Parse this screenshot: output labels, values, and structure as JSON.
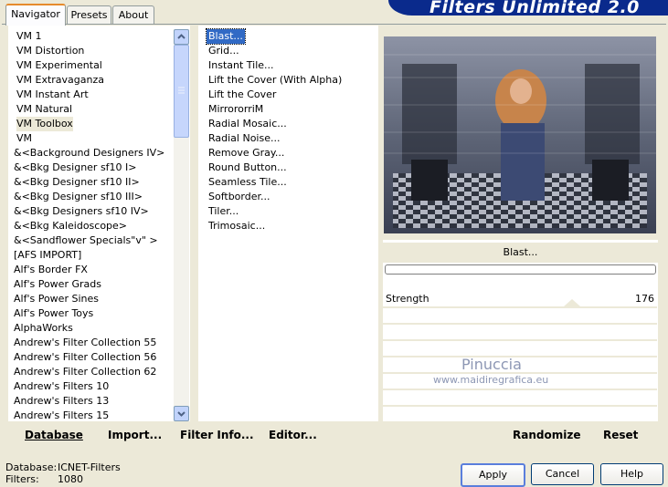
{
  "tabs": [
    {
      "label": "Navigator"
    },
    {
      "label": "Presets"
    },
    {
      "label": "About"
    }
  ],
  "header": {
    "title": "Filters Unlimited 2.0"
  },
  "categories": [
    "VM 1",
    "VM Distortion",
    "VM Experimental",
    "VM Extravaganza",
    "VM Instant Art",
    "VM Natural",
    "VM Toolbox",
    "VM",
    "&<Background Designers IV>",
    "&<Bkg Designer sf10 I>",
    "&<Bkg Designer sf10 II>",
    "&<Bkg Designer sf10 III>",
    "&<Bkg Designers sf10 IV>",
    "&<Bkg Kaleidoscope>",
    "&<Sandflower Specials\"v\" >",
    "[AFS IMPORT]",
    "Alf's Border FX",
    "Alf's Power Grads",
    "Alf's Power Sines",
    "Alf's Power Toys",
    "AlphaWorks",
    "Andrew's Filter Collection 55",
    "Andrew's Filter Collection 56",
    "Andrew's Filter Collection 62",
    "Andrew's Filters 10",
    "Andrew's Filters 13",
    "Andrew's Filters 15"
  ],
  "selected_category": "VM Toolbox",
  "filters": [
    "Blast...",
    "Grid...",
    "Instant Tile...",
    "Lift the Cover (With Alpha)",
    "Lift the Cover",
    "MirrororriM",
    "Radial Mosaic...",
    "Radial Noise...",
    "Remove Gray...",
    "Round Button...",
    "Seamless Tile...",
    "Softborder...",
    "Tiler...",
    "Trimosaic..."
  ],
  "selected_filter": "Blast...",
  "preview": {
    "current_filter_name": "Blast...",
    "progress_pct": 0
  },
  "watermark": {
    "name": "Pinuccia",
    "url": "www.maidiregrafica.eu"
  },
  "parameters": [
    {
      "label": "Strength",
      "value": "176"
    }
  ],
  "left_toolbar": {
    "database": "Database",
    "import": "Import...",
    "filter_info": "Filter Info...",
    "editor": "Editor..."
  },
  "right_toolbar": {
    "randomize": "Randomize",
    "reset": "Reset"
  },
  "status": {
    "database_label": "Database:",
    "database_value": "ICNET-Filters",
    "filters_label": "Filters:",
    "filters_value": "1080"
  },
  "dialog_buttons": {
    "apply": "Apply",
    "cancel": "Cancel",
    "help": "Help"
  }
}
